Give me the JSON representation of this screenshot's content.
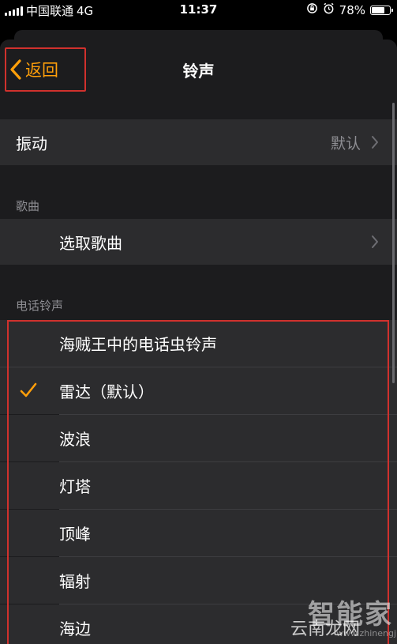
{
  "status_bar": {
    "carrier": "中国联通",
    "network": "4G",
    "time": "11:37",
    "battery": "78%",
    "battery_level": 0.78
  },
  "nav": {
    "back_label": "返回",
    "title": "铃声"
  },
  "vibration": {
    "label": "振动",
    "value": "默认"
  },
  "songs_section": {
    "header": "歌曲",
    "pick_label": "选取歌曲"
  },
  "ringtones_section": {
    "header": "电话铃声",
    "items": [
      {
        "label": "海贼王中的电话虫铃声",
        "selected": false
      },
      {
        "label": "雷达（默认）",
        "selected": true
      },
      {
        "label": "波浪",
        "selected": false
      },
      {
        "label": "灯塔",
        "selected": false
      },
      {
        "label": "顶峰",
        "selected": false
      },
      {
        "label": "辐射",
        "selected": false
      },
      {
        "label": "海边",
        "selected": false
      }
    ]
  },
  "watermark": {
    "brand": "智能家",
    "site": "云南龙网",
    "url": "www.zhinengjia.com"
  },
  "colors": {
    "accent": "#ff9f0a",
    "highlight_box": "#d0312d",
    "cell_bg": "#2c2c2e",
    "group_bg": "#1c1c1e"
  }
}
